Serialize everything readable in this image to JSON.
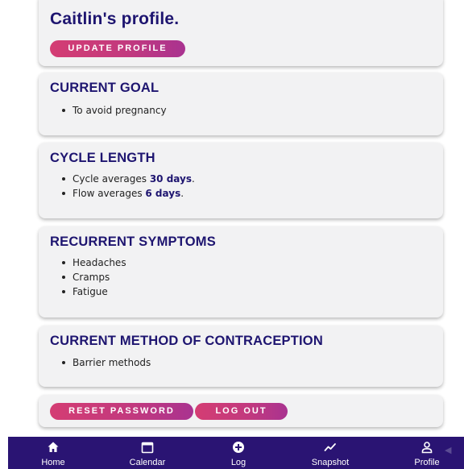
{
  "profile": {
    "title": "Caitlin's profile.",
    "update_button": "UPDATE PROFILE"
  },
  "goal": {
    "heading": "CURRENT GOAL",
    "items": [
      "To avoid pregnancy"
    ]
  },
  "cycle": {
    "heading": "CYCLE LENGTH",
    "cycle_prefix": "Cycle averages ",
    "cycle_value": "30 days",
    "cycle_suffix": ".",
    "flow_prefix": "Flow averages ",
    "flow_value": "6 days",
    "flow_suffix": "."
  },
  "symptoms": {
    "heading": "RECURRENT SYMPTOMS",
    "items": [
      "Headaches",
      "Cramps",
      "Fatigue"
    ]
  },
  "contraception": {
    "heading": "CURRENT METHOD OF CONTRACEPTION",
    "items": [
      "Barrier methods"
    ]
  },
  "account": {
    "reset_button": "RESET PASSWORD",
    "logout_button": "LOG OUT"
  },
  "nav": {
    "items": [
      {
        "label": "Home",
        "icon": "home-icon"
      },
      {
        "label": "Calendar",
        "icon": "calendar-icon"
      },
      {
        "label": "Log",
        "icon": "plus-circle-icon"
      },
      {
        "label": "Snapshot",
        "icon": "trend-icon"
      },
      {
        "label": "Profile",
        "icon": "person-icon"
      }
    ],
    "active": "Profile"
  },
  "colors": {
    "primary": "#1e1570",
    "navbar": "#2a1473",
    "button_gradient_start": "#d43d73",
    "button_gradient_end": "#a93390",
    "card_background": "#f2f2f3"
  }
}
